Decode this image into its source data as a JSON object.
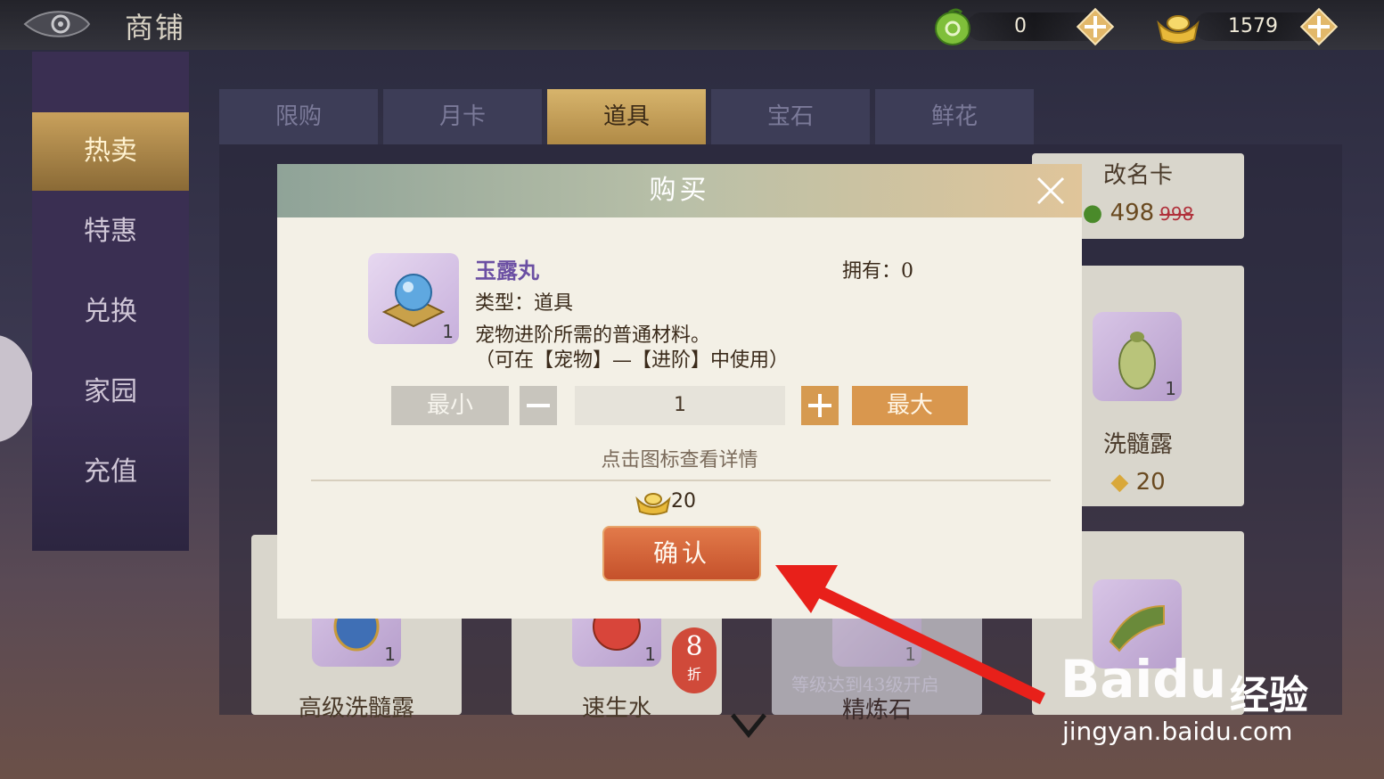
{
  "header": {
    "title": "商铺",
    "currency_jade": "0",
    "currency_gold": "1579"
  },
  "sidebar": {
    "items": [
      {
        "label": "热卖",
        "active": true
      },
      {
        "label": "特惠",
        "active": false
      },
      {
        "label": "兑换",
        "active": false
      },
      {
        "label": "家园",
        "active": false
      },
      {
        "label": "充值",
        "active": false
      }
    ]
  },
  "tabs": [
    {
      "label": "限购",
      "active": false
    },
    {
      "label": "月卡",
      "active": false
    },
    {
      "label": "道具",
      "active": true
    },
    {
      "label": "宝石",
      "active": false
    },
    {
      "label": "鲜花",
      "active": false
    }
  ],
  "shop_cards": {
    "rename_card": {
      "name": "改名卡",
      "price": "498",
      "old_price": "998"
    },
    "marrow_dew": {
      "name": "洗髓露",
      "price": "20",
      "count": "1"
    },
    "adv_marrow_dew": {
      "name": "高级洗髓露",
      "count": "1"
    },
    "quick_water": {
      "name": "速生水",
      "count": "1",
      "discount": "8",
      "discount_unit": "折"
    },
    "refine_stone": {
      "name": "精炼石",
      "count": "1",
      "locked_text": "等级达到43级开启"
    }
  },
  "dialog": {
    "title": "购买",
    "item_name": "玉露丸",
    "item_type": "类型：道具",
    "owned": "拥有：0",
    "desc_line1": "宠物进阶所需的普通材料。",
    "desc_line2": "（可在【宠物】—【进阶】中使用）",
    "thumb_count": "1",
    "btn_min": "最小",
    "qty": "1",
    "btn_max": "最大",
    "hint": "点击图标查看详情",
    "cost": "20",
    "confirm": "确认"
  },
  "watermark": {
    "logo": "Baidu",
    "jy": "经验",
    "url": "jingyan.baidu.com"
  },
  "colors": {
    "accent_orange": "#d9974e",
    "confirm_red": "#c5512b",
    "item_name_purple": "#6b4fa3"
  }
}
